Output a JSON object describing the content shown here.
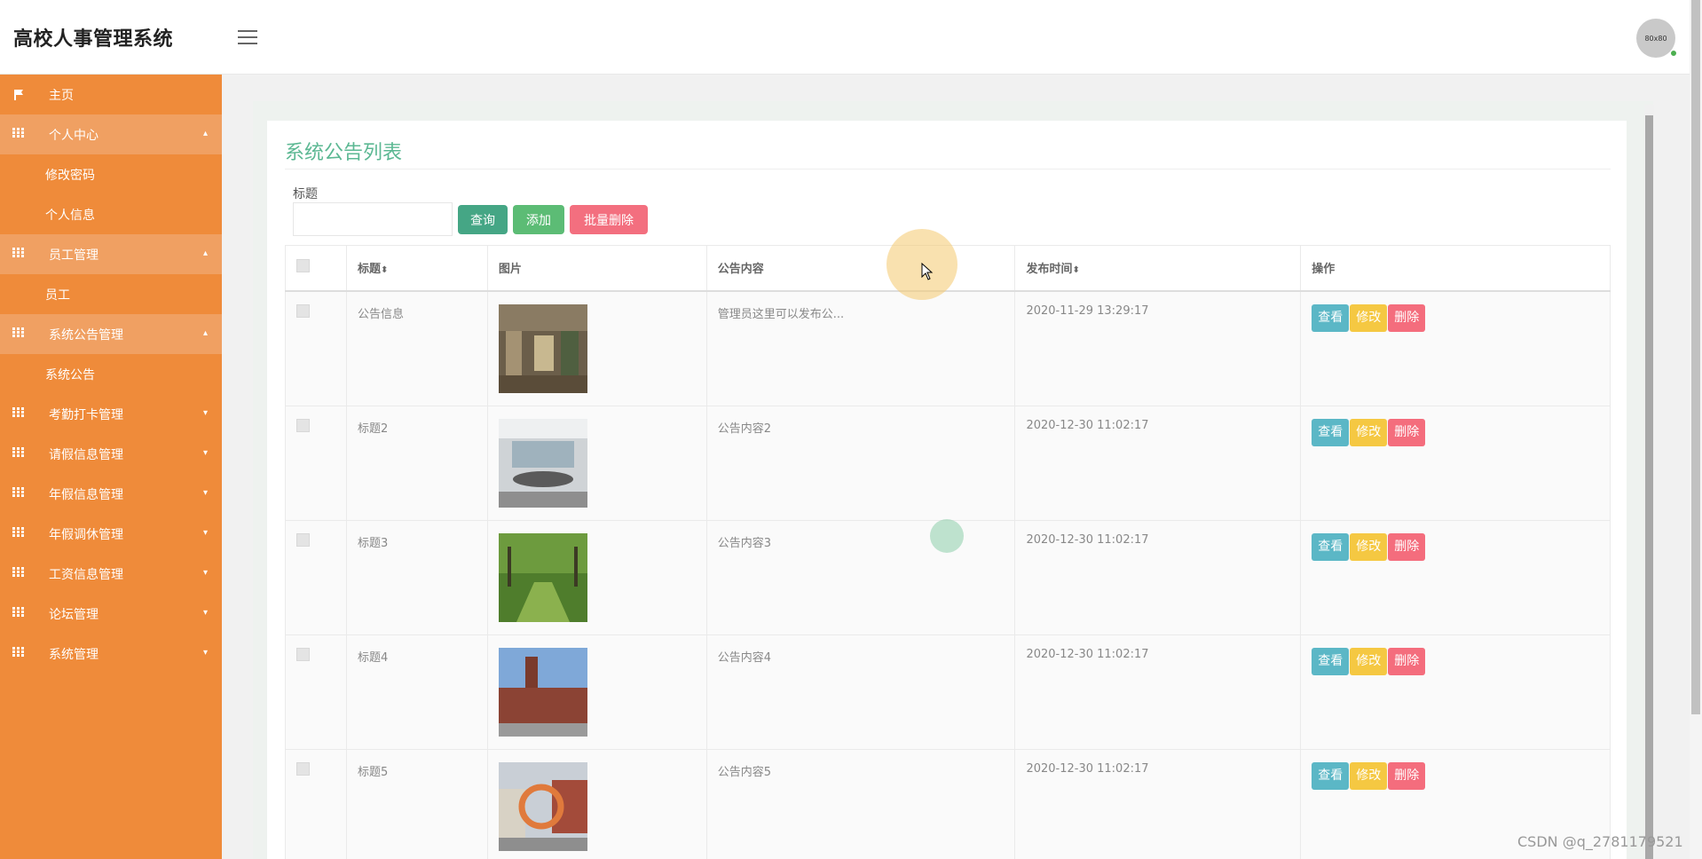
{
  "app": {
    "title": "高校人事管理系统",
    "avatar_text": "80x80"
  },
  "sidebar": {
    "items": [
      {
        "label": "主页",
        "icon": "flag-icon",
        "children": []
      },
      {
        "label": "个人中心",
        "icon": "grid-icon",
        "open": true,
        "children": [
          "修改密码",
          "个人信息"
        ]
      },
      {
        "label": "员工管理",
        "icon": "grid-icon",
        "open": true,
        "children": [
          "员工"
        ]
      },
      {
        "label": "系统公告管理",
        "icon": "grid-icon",
        "open": true,
        "children": [
          "系统公告"
        ]
      },
      {
        "label": "考勤打卡管理",
        "icon": "grid-icon",
        "children": []
      },
      {
        "label": "请假信息管理",
        "icon": "grid-icon",
        "children": []
      },
      {
        "label": "年假信息管理",
        "icon": "grid-icon",
        "children": []
      },
      {
        "label": "年假调休管理",
        "icon": "grid-icon",
        "children": []
      },
      {
        "label": "工资信息管理",
        "icon": "grid-icon",
        "children": []
      },
      {
        "label": "论坛管理",
        "icon": "grid-icon",
        "children": []
      },
      {
        "label": "系统管理",
        "icon": "grid-icon",
        "children": []
      }
    ]
  },
  "page": {
    "title": "系统公告列表",
    "search": {
      "label": "标题",
      "value": "",
      "placeholder": ""
    },
    "buttons": {
      "query": "查询",
      "add": "添加",
      "batch_delete": "批量删除"
    }
  },
  "table": {
    "headers": {
      "title": "标题",
      "image": "图片",
      "content": "公告内容",
      "time": "发布时间",
      "actions": "操作"
    },
    "sort_glyph": "⬍",
    "actions": {
      "view": "查看",
      "edit": "修改",
      "delete": "删除"
    },
    "rows": [
      {
        "title": "公告信息",
        "content": "管理员这里可以发布公...",
        "time": "2020-11-29 13:29:17",
        "image_theme": "office-interior"
      },
      {
        "title": "标题2",
        "content": "公告内容2",
        "time": "2020-12-30 11:02:17",
        "image_theme": "meeting-room"
      },
      {
        "title": "标题3",
        "content": "公告内容3",
        "time": "2020-12-30 11:02:17",
        "image_theme": "park-trees"
      },
      {
        "title": "标题4",
        "content": "公告内容4",
        "time": "2020-12-30 11:02:17",
        "image_theme": "clock-tower-building"
      },
      {
        "title": "标题5",
        "content": "公告内容5",
        "time": "2020-12-30 11:02:17",
        "image_theme": "ring-sculpture"
      }
    ]
  },
  "watermark": "CSDN @q_2781179521",
  "colors": {
    "sidebar": "#ef8b3a",
    "accent": "#5cb893",
    "view": "#5bb7c6",
    "edit": "#f5c842",
    "delete": "#f46d7d"
  }
}
